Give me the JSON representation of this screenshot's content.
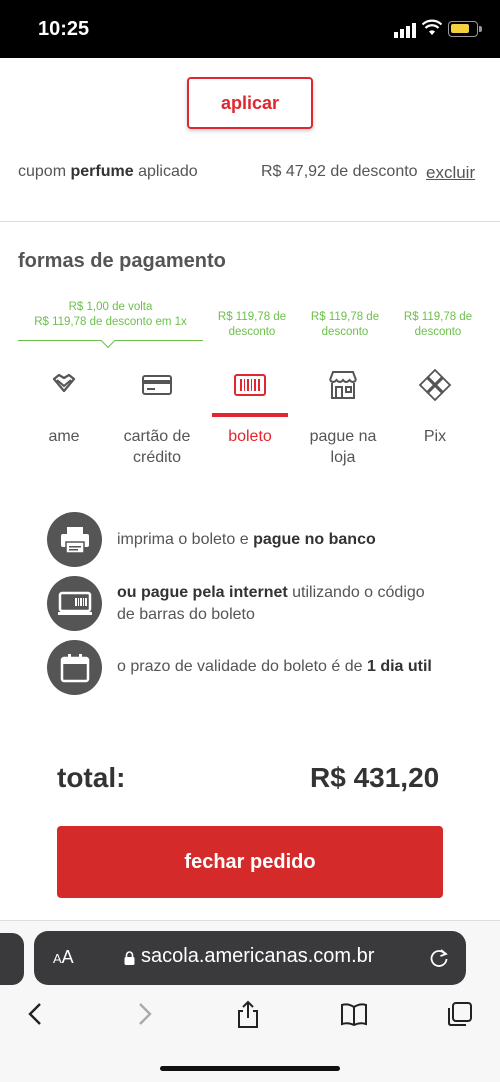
{
  "status_bar": {
    "time": "10:25"
  },
  "coupon": {
    "apply_label": "aplicar",
    "prefix": "cupom",
    "code": "perfume",
    "suffix": "aplicado",
    "discount": "R$ 47,92 de desconto",
    "remove_label": "excluir"
  },
  "payment": {
    "title": "formas de pagamento",
    "promos": [
      {
        "line1": "R$ 1,00 de volta",
        "line2": "R$ 119,78 de desconto em 1x"
      },
      {
        "line1": "R$ 119,78 de",
        "line2": "desconto"
      },
      {
        "line1": "R$ 119,78 de",
        "line2": "desconto"
      },
      {
        "line1": "R$ 119,78 de",
        "line2": "desconto"
      }
    ],
    "methods": [
      {
        "line1": "ame",
        "line2": "",
        "icon": "ame-heart-icon"
      },
      {
        "line1": "cartão de",
        "line2": "crédito",
        "icon": "credit-card-icon"
      },
      {
        "line1": "boleto",
        "line2": "",
        "icon": "barcode-icon",
        "active": true
      },
      {
        "line1": "pague na",
        "line2": "loja",
        "icon": "store-icon"
      },
      {
        "line1": "Pix",
        "line2": "",
        "icon": "pix-icon"
      }
    ]
  },
  "boleto_info": {
    "item1": {
      "text": "imprima o boleto e ",
      "bold": "pague no banco"
    },
    "item2": {
      "bold": "ou pague pela internet",
      "text": " utilizando o código",
      "line2": "de barras do boleto"
    },
    "item3": {
      "text": "o prazo de validade do boleto é de ",
      "bold": "1 dia util"
    }
  },
  "summary": {
    "total_label": "total:",
    "total_value": "R$ 431,20",
    "checkout_label": "fechar pedido"
  },
  "browser": {
    "text_size_label": "AA",
    "url": "sacola.americanas.com.br"
  },
  "colors": {
    "accent": "#e0262e",
    "checkout": "#d42a29",
    "promo": "#6cc04a"
  }
}
